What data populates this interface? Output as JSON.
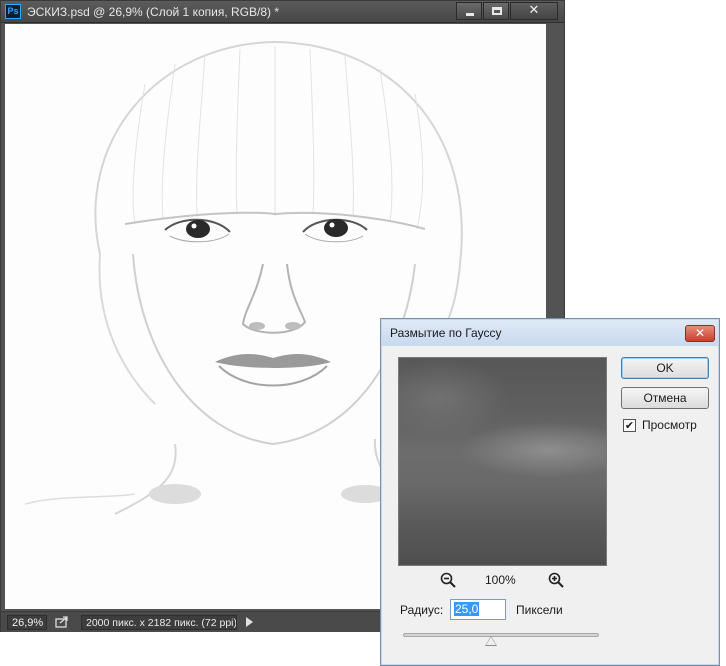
{
  "document": {
    "app_icon": "Ps",
    "title": "ЭСКИЗ.psd @ 26,9% (Слой 1 копия, RGB/8) *",
    "window_controls": [
      "minimize-icon",
      "maximize-icon",
      "close-icon"
    ],
    "close_glyph": "✕",
    "status": {
      "zoom": "26,9%",
      "info": "2000 пикс. x 2182 пикс. (72 ppi)"
    }
  },
  "dialog": {
    "title": "Размытие по Гауссу",
    "close_glyph": "✕",
    "ok_label": "OK",
    "cancel_label": "Отмена",
    "preview_label": "Просмотр",
    "preview_checked": true,
    "check_glyph": "✔",
    "zoom_level": "100%",
    "radius_label": "Радиус:",
    "radius_value": "25,0",
    "unit_label": "Пиксели",
    "slider_position": 0.45,
    "accent_color": "#3399ff"
  }
}
